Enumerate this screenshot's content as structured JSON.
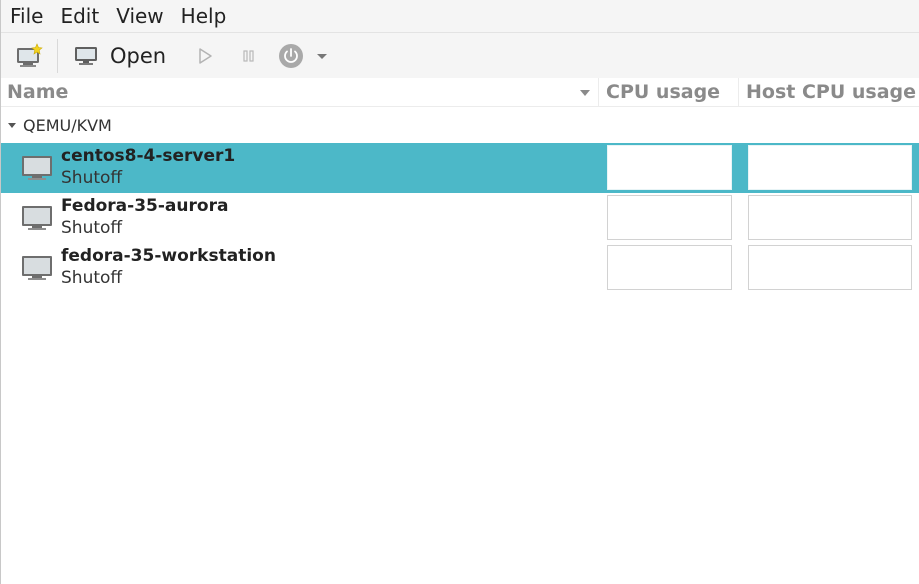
{
  "menu": {
    "items": [
      "File",
      "Edit",
      "View",
      "Help"
    ]
  },
  "toolbar": {
    "new_icon": "new-vm-icon",
    "open_label": "Open",
    "open_icon": "monitor-icon",
    "run_icon": "play-icon",
    "pause_icon": "pause-icon",
    "shutdown_icon": "power-icon",
    "dropdown_icon": "chevron-down-icon"
  },
  "columns": {
    "name": "Name",
    "cpu": "CPU usage",
    "host_cpu": "Host CPU usage"
  },
  "group": {
    "label": "QEMU/KVM"
  },
  "vms": [
    {
      "name": "centos8-4-server1",
      "status": "Shutoff",
      "selected": true
    },
    {
      "name": "Fedora-35-aurora",
      "status": "Shutoff",
      "selected": false
    },
    {
      "name": "fedora-35-workstation",
      "status": "Shutoff",
      "selected": false
    }
  ],
  "colors": {
    "selection": "#4cb8c8",
    "header_text": "#8a8a8a",
    "toolbar_bg": "#f5f5f5"
  }
}
